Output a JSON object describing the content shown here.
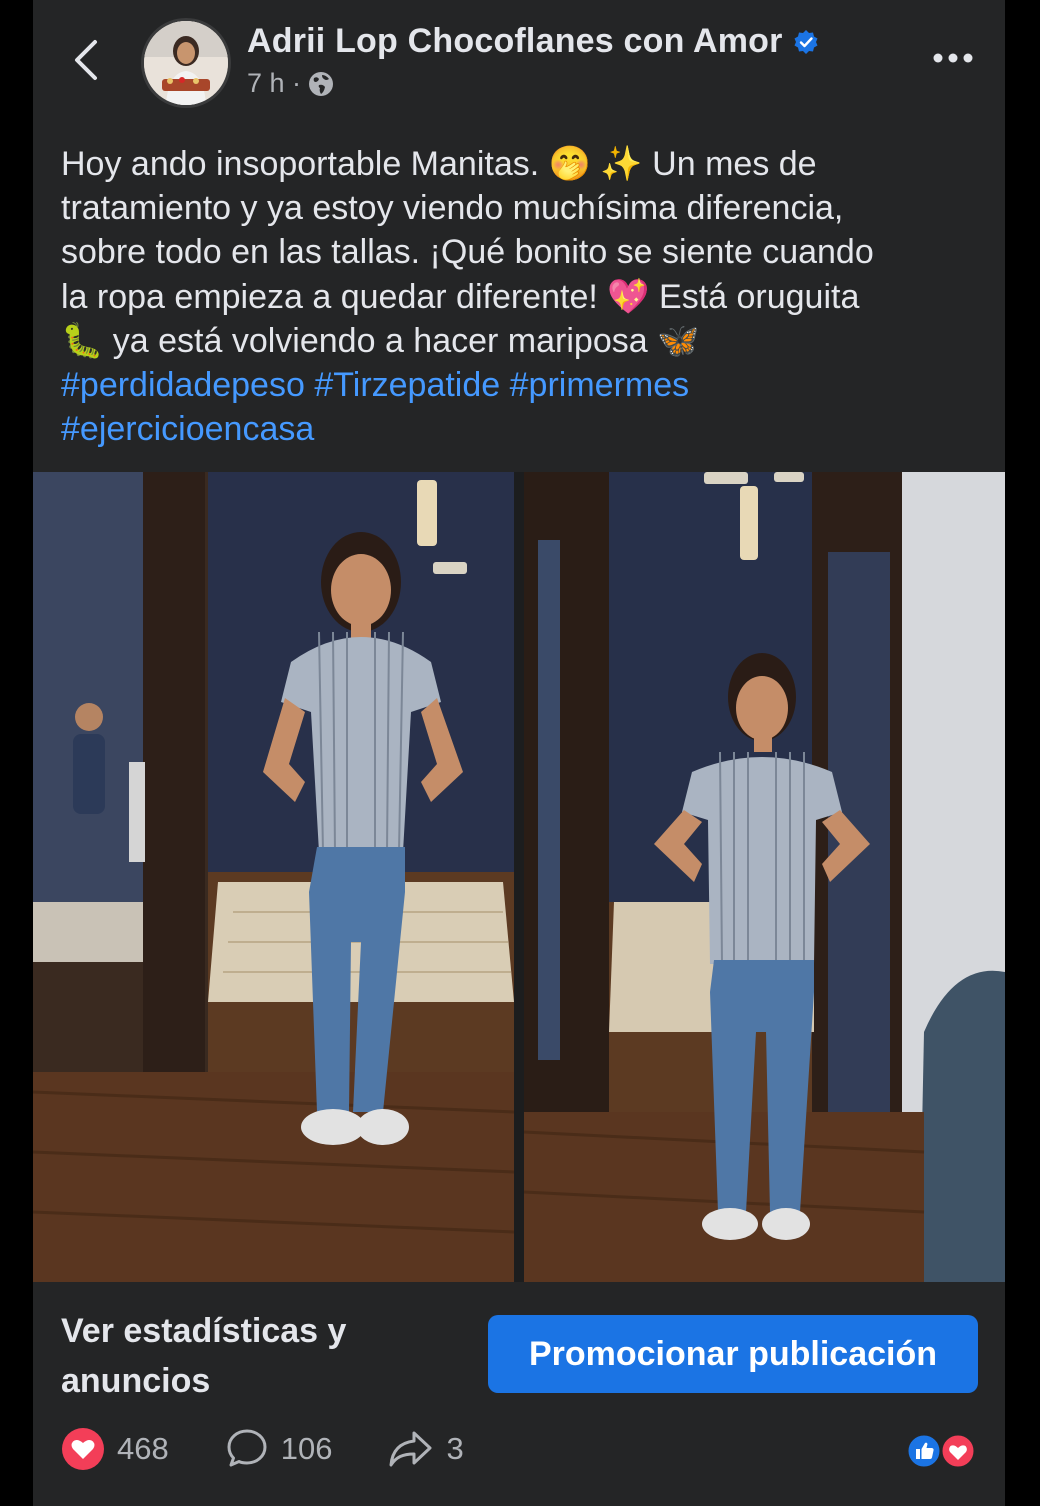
{
  "header": {
    "author_name": "Adrii Lop Chocoflanes con Amor",
    "time": "7 h ·"
  },
  "caption": {
    "line1": "Hoy ando insoportable Manitas. 🤭 ✨ Un mes de",
    "line2": "tratamiento y ya estoy viendo muchísima diferencia,",
    "line3": "sobre todo en las tallas. ¡Qué bonito se siente cuando",
    "line4": "la ropa empieza a quedar diferente! 💖  Está oruguita",
    "line5": "🐛 ya está volviendo a hacer mariposa 🦋",
    "hashtags": [
      "#perdidadepeso",
      "#Tirzepatide",
      "#primermes",
      "#ejercicioencasa"
    ]
  },
  "actions": {
    "stats_label": "Ver estadísticas y anuncios",
    "promote_label": "Promocionar publicación"
  },
  "reactions": {
    "likes": "468",
    "comments": "106",
    "shares": "3"
  },
  "colors": {
    "background": "#242526",
    "text": "#e4e6eb",
    "muted": "#b0b3b8",
    "link": "#4599ff",
    "accent": "#1b74e4",
    "heart": "#f33e58"
  },
  "icons": {
    "back": "chevron-left-icon",
    "verified": "verified-badge-icon",
    "privacy": "globe-icon",
    "more": "more-horizontal-icon",
    "like": "heart-icon",
    "comment": "comment-icon",
    "share": "share-icon"
  }
}
